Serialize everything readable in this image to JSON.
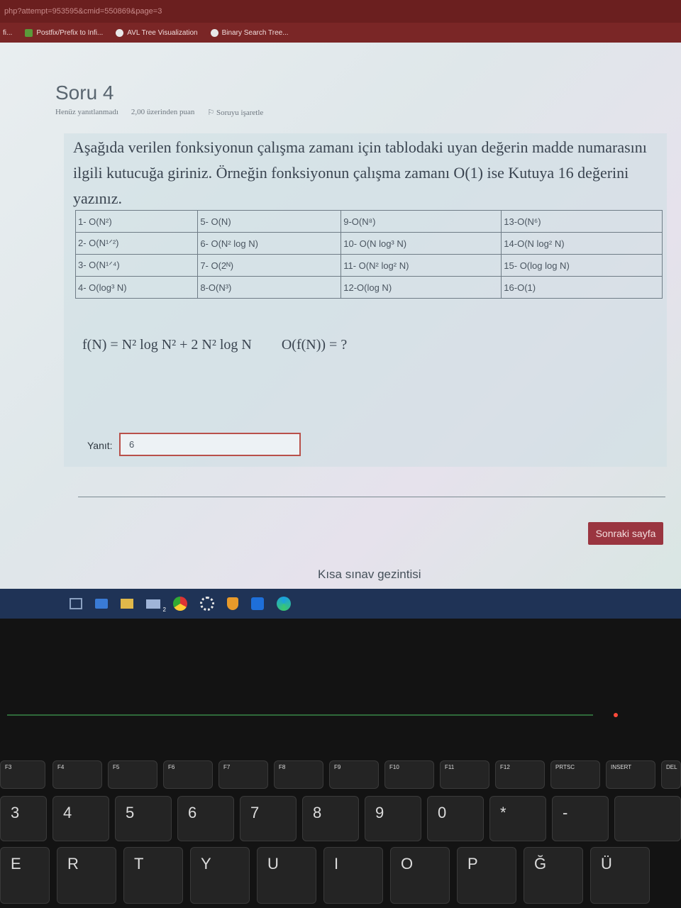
{
  "browser": {
    "url": "php?attempt=953595&cmid=550869&page=3",
    "bookmarks": [
      {
        "label": "fi..."
      },
      {
        "label": "Postfix/Prefix to Infi..."
      },
      {
        "label": "AVL Tree Visualization"
      },
      {
        "label": "Binary Search Tree..."
      }
    ]
  },
  "question": {
    "title": "Soru 4",
    "status": "Henüz yanıtlanmadı",
    "points": "2,00 üzerinden puan",
    "flag": "Soruyu işaretle",
    "text": "Aşağıda verilen fonksiyonun çalışma zamanı için tablodaki uyan değerin madde numarasını ilgili kutucuğa giriniz. Örneğin fonksiyonun çalışma zamanı O(1) ise Kutuya 16 değerini yazınız.",
    "options": [
      [
        "1- O(N²)",
        "5- O(N)",
        "9-O(N⁸)",
        "13-O(N⁶)"
      ],
      [
        "2- O(N¹ᐟ²)",
        "6- O(N² log N)",
        "10- O(N log³ N)",
        "14-O(N log² N)"
      ],
      [
        "3- O(N¹ᐟ⁴)",
        "7- O(2ᴺ)",
        "11- O(N² log² N)",
        "15- O(log log N)"
      ],
      [
        "4- O(log³ N)",
        "8-O(N³)",
        "12-O(log N)",
        "16-O(1)"
      ]
    ],
    "formula": "f(N) = N² log N² + 2 N² log N",
    "formula_question": "O(f(N)) = ?",
    "answer_label": "Yanıt:",
    "answer_value": "6"
  },
  "navigation": {
    "next_button": "Sonraki sayfa",
    "quiz_nav": "Kısa sınav gezintisi"
  },
  "taskbar": {
    "icons": [
      "task-view-icon",
      "file-explorer-icon",
      "folder-icon",
      "mail-icon",
      "chrome-icon",
      "settings-icon",
      "shield-icon",
      "camera-icon",
      "edge-icon"
    ],
    "mail_badge": "2"
  },
  "keyboard": {
    "fn_keys": [
      {
        "label": "F3"
      },
      {
        "label": "F4"
      },
      {
        "label": "F5"
      },
      {
        "label": "F6"
      },
      {
        "label": "F7"
      },
      {
        "label": "F8"
      },
      {
        "label": "F9"
      },
      {
        "label": "F10"
      },
      {
        "label": "F11"
      },
      {
        "label": "F12"
      },
      {
        "label": "PRTSC"
      },
      {
        "label": "INSERT"
      },
      {
        "label": "DEL"
      }
    ],
    "number_keys": [
      "3",
      "4",
      "5",
      "6",
      "7",
      "8",
      "9",
      "0",
      "*",
      "-"
    ],
    "letter_keys": [
      "E",
      "R",
      "T",
      "Y",
      "U",
      "I",
      "O",
      "P",
      "Ğ",
      "Ü"
    ]
  }
}
